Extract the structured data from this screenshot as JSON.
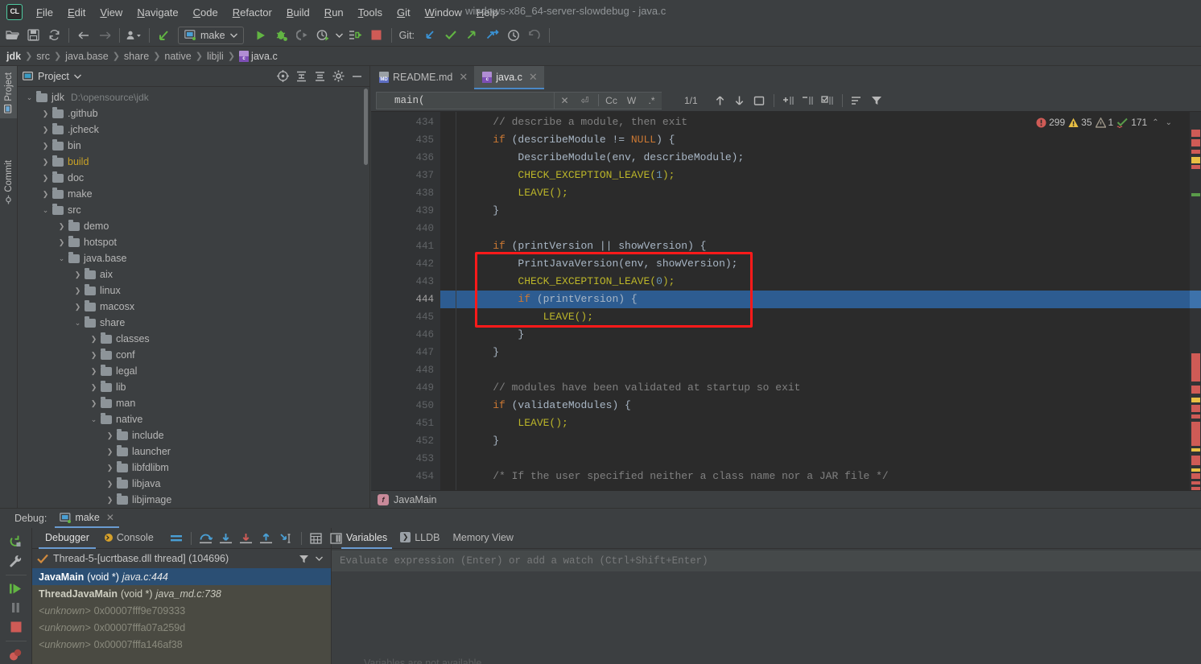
{
  "window": {
    "title": "windows-x86_64-server-slowdebug - java.c",
    "logo": "CL"
  },
  "menu": {
    "items": [
      {
        "label": "File",
        "mnemonic": "F"
      },
      {
        "label": "Edit",
        "mnemonic": "E"
      },
      {
        "label": "View",
        "mnemonic": "V"
      },
      {
        "label": "Navigate",
        "mnemonic": "N"
      },
      {
        "label": "Code",
        "mnemonic": "C"
      },
      {
        "label": "Refactor",
        "mnemonic": "R"
      },
      {
        "label": "Build",
        "mnemonic": "B"
      },
      {
        "label": "Run",
        "mnemonic": "R"
      },
      {
        "label": "Tools",
        "mnemonic": "T"
      },
      {
        "label": "Git",
        "mnemonic": "G"
      },
      {
        "label": "Window",
        "mnemonic": "W"
      },
      {
        "label": "Help",
        "mnemonic": "H"
      }
    ]
  },
  "toolbar": {
    "open_icon": "open-folder-icon",
    "save_icon": "save-icon",
    "sync_icon": "sync-icon",
    "back_icon": "back-arrow-icon",
    "forward_icon": "forward-arrow-icon",
    "profile_icon": "user-dropdown-icon",
    "update_icon": "update-project-icon",
    "run_config": "make",
    "run_icon": "run-icon",
    "debug_icon": "debug-icon",
    "coverage_icon": "run-with-coverage-icon",
    "profiler_icon": "profiler-icon",
    "attach_icon": "attach-debugger-icon",
    "stop_icon": "stop-icon",
    "git_label": "Git:",
    "git_update_icon": "git-update-icon",
    "git_commit_icon": "git-commit-icon",
    "git_push_icon": "git-push-icon",
    "git_branch_icon": "git-branch-icon",
    "git_history_icon": "git-history-icon",
    "git_rollback_icon": "git-rollback-icon"
  },
  "breadcrumb": {
    "items": [
      "jdk",
      "src",
      "java.base",
      "share",
      "native",
      "libjli",
      "java.c"
    ]
  },
  "stripes": {
    "left": [
      "Project",
      "Commit"
    ]
  },
  "project_panel": {
    "title": "Project",
    "tree": [
      {
        "label": "jdk",
        "path": "D:\\opensource\\jdk",
        "depth": 0,
        "state": "open",
        "root": true
      },
      {
        "label": ".github",
        "depth": 1,
        "state": "closed"
      },
      {
        "label": ".jcheck",
        "depth": 1,
        "state": "closed"
      },
      {
        "label": "bin",
        "depth": 1,
        "state": "closed"
      },
      {
        "label": "build",
        "depth": 1,
        "state": "closed",
        "color": "yellow"
      },
      {
        "label": "doc",
        "depth": 1,
        "state": "closed"
      },
      {
        "label": "make",
        "depth": 1,
        "state": "closed"
      },
      {
        "label": "src",
        "depth": 1,
        "state": "open"
      },
      {
        "label": "demo",
        "depth": 2,
        "state": "closed"
      },
      {
        "label": "hotspot",
        "depth": 2,
        "state": "closed"
      },
      {
        "label": "java.base",
        "depth": 2,
        "state": "open"
      },
      {
        "label": "aix",
        "depth": 3,
        "state": "closed"
      },
      {
        "label": "linux",
        "depth": 3,
        "state": "closed"
      },
      {
        "label": "macosx",
        "depth": 3,
        "state": "closed"
      },
      {
        "label": "share",
        "depth": 3,
        "state": "open"
      },
      {
        "label": "classes",
        "depth": 4,
        "state": "closed"
      },
      {
        "label": "conf",
        "depth": 4,
        "state": "closed"
      },
      {
        "label": "legal",
        "depth": 4,
        "state": "closed"
      },
      {
        "label": "lib",
        "depth": 4,
        "state": "closed"
      },
      {
        "label": "man",
        "depth": 4,
        "state": "closed"
      },
      {
        "label": "native",
        "depth": 4,
        "state": "open"
      },
      {
        "label": "include",
        "depth": 5,
        "state": "closed"
      },
      {
        "label": "launcher",
        "depth": 5,
        "state": "closed"
      },
      {
        "label": "libfdlibm",
        "depth": 5,
        "state": "closed"
      },
      {
        "label": "libjava",
        "depth": 5,
        "state": "closed"
      },
      {
        "label": "libjimage",
        "depth": 5,
        "state": "closed"
      }
    ]
  },
  "editor": {
    "tabs": [
      {
        "label": "README.md",
        "icon": "md",
        "badge": "MD",
        "active": false
      },
      {
        "label": "java.c",
        "icon": "c",
        "badge": "c",
        "active": true
      }
    ],
    "find": {
      "value": "main(",
      "count": "1/1",
      "options": [
        "Cc",
        "W",
        ".*"
      ],
      "close_icon": "close-icon",
      "multiline_icon": "multiline-icon",
      "prev_icon": "find-previous-icon",
      "next_icon": "find-next-icon",
      "select_all_icon": "select-all-occurrences-icon",
      "add_icon": "add-line-icon",
      "remove_icon": "remove-line-icon",
      "edit_icon": "edit-selection-icon",
      "sort_icon": "sort-icon",
      "filter_icon": "filter-icon"
    },
    "inspections": {
      "errors": "299",
      "warnings": "35",
      "weak_warnings": "1",
      "typos": "171"
    },
    "breadcrumb_symbol": "JavaMain",
    "lines": [
      {
        "no": "434",
        "indent": 4,
        "tokens": [
          {
            "t": "// describe a module, then exit",
            "c": "com"
          }
        ]
      },
      {
        "no": "435",
        "indent": 4,
        "fold": "open",
        "tokens": [
          {
            "t": "if",
            "c": "kw"
          },
          {
            "t": " (describeModule != ",
            "c": "pun"
          },
          {
            "t": "NULL",
            "c": "kw"
          },
          {
            "t": ") {",
            "c": "pun"
          }
        ]
      },
      {
        "no": "436",
        "indent": 8,
        "tokens": [
          {
            "t": "DescribeModule(env, describeModule);",
            "c": "pun"
          }
        ]
      },
      {
        "no": "437",
        "indent": 8,
        "tokens": [
          {
            "t": "CHECK_EXCEPTION_LEAVE(",
            "c": "mac"
          },
          {
            "t": "1",
            "c": "num"
          },
          {
            "t": ");",
            "c": "mac"
          }
        ]
      },
      {
        "no": "438",
        "indent": 8,
        "tokens": [
          {
            "t": "LEAVE();",
            "c": "mac"
          }
        ]
      },
      {
        "no": "439",
        "indent": 4,
        "fold": "close",
        "tokens": [
          {
            "t": "}",
            "c": "pun"
          }
        ]
      },
      {
        "no": "440",
        "indent": 0,
        "tokens": []
      },
      {
        "no": "441",
        "indent": 4,
        "fold": "open",
        "tokens": [
          {
            "t": "if",
            "c": "kw"
          },
          {
            "t": " (printVersion || showVersion) {",
            "c": "pun"
          }
        ]
      },
      {
        "no": "442",
        "indent": 8,
        "tokens": [
          {
            "t": "PrintJavaVersion(env, showVersion);",
            "c": "pun"
          }
        ]
      },
      {
        "no": "443",
        "indent": 8,
        "tokens": [
          {
            "t": "CHECK_EXCEPTION_LEAVE(",
            "c": "mac"
          },
          {
            "t": "0",
            "c": "num"
          },
          {
            "t": ");",
            "c": "mac"
          }
        ]
      },
      {
        "no": "444",
        "indent": 8,
        "current": true,
        "fold": "open",
        "tokens": [
          {
            "t": "if",
            "c": "kw"
          },
          {
            "t": " (printVersion) {",
            "c": "pun"
          }
        ]
      },
      {
        "no": "445",
        "indent": 12,
        "tokens": [
          {
            "t": "LEAVE();",
            "c": "mac"
          }
        ]
      },
      {
        "no": "446",
        "indent": 8,
        "fold": "close",
        "tokens": [
          {
            "t": "}",
            "c": "pun"
          }
        ]
      },
      {
        "no": "447",
        "indent": 4,
        "fold": "close",
        "tokens": [
          {
            "t": "}",
            "c": "pun"
          }
        ]
      },
      {
        "no": "448",
        "indent": 0,
        "tokens": []
      },
      {
        "no": "449",
        "indent": 4,
        "tokens": [
          {
            "t": "// modules have been validated at startup so exit",
            "c": "com"
          }
        ]
      },
      {
        "no": "450",
        "indent": 4,
        "fold": "open",
        "tokens": [
          {
            "t": "if",
            "c": "kw"
          },
          {
            "t": " (validateModules) {",
            "c": "pun"
          }
        ]
      },
      {
        "no": "451",
        "indent": 8,
        "tokens": [
          {
            "t": "LEAVE();",
            "c": "mac"
          }
        ]
      },
      {
        "no": "452",
        "indent": 4,
        "fold": "close",
        "tokens": [
          {
            "t": "}",
            "c": "pun"
          }
        ]
      },
      {
        "no": "453",
        "indent": 0,
        "tokens": []
      },
      {
        "no": "454",
        "indent": 4,
        "tokens": [
          {
            "t": "/* If the user specified neither a class name nor a JAR file */",
            "c": "com"
          }
        ]
      }
    ]
  },
  "debug": {
    "header_label": "Debug:",
    "session_name": "make",
    "tabs": [
      {
        "label": "Debugger",
        "active": true
      },
      {
        "label": "Console",
        "active": false
      }
    ],
    "toolbar_icons": [
      "show-execution-point-icon",
      "step-over-icon",
      "step-into-icon",
      "force-step-into-icon",
      "step-out-icon",
      "run-to-cursor-icon",
      "evaluate-expression-icon",
      "layout-settings-icon"
    ],
    "side_icons": [
      "rerun-icon",
      "settings-wrench-icon",
      "resume-program-icon",
      "pause-program-icon",
      "stop-icon",
      "view-breakpoints-icon"
    ],
    "thread": "Thread-5-[ucrtbase.dll thread] (104696)",
    "thread_filter_icon": "filter-icon",
    "thread_dropdown_icon": "chevron-down-icon",
    "frames": [
      {
        "name": "JavaMain",
        "args": "(void *)",
        "loc": "java.c:444",
        "selected": true
      },
      {
        "name": "ThreadJavaMain",
        "args": "(void *)",
        "loc": "java_md.c:738",
        "selected": false
      },
      {
        "name": "<unknown>",
        "args": "",
        "loc": "0x00007fff9e709333",
        "unknown": true
      },
      {
        "name": "<unknown>",
        "args": "",
        "loc": "0x00007fffa07a259d",
        "unknown": true
      },
      {
        "name": "<unknown>",
        "args": "",
        "loc": "0x00007fffa146af38",
        "unknown": true
      }
    ],
    "var_tabs": [
      {
        "label": "Variables",
        "active": true,
        "icon": null
      },
      {
        "label": "LLDB",
        "active": false,
        "icon": "lldb-icon"
      },
      {
        "label": "Memory View",
        "active": false,
        "icon": null
      }
    ],
    "evaluate_placeholder": "Evaluate expression (Enter) or add a watch (Ctrl+Shift+Enter)"
  },
  "colors": {
    "accent_blue": "#4a88c7",
    "selection_blue": "#2d5c91",
    "highlight_red": "#ff1a1a",
    "error_red": "#cf5b56",
    "warning_yellow": "#e8bf43",
    "green": "#5a9c4a",
    "keyword_orange": "#cc7832",
    "macro_olive": "#bbb529",
    "comment_gray": "#808080"
  }
}
